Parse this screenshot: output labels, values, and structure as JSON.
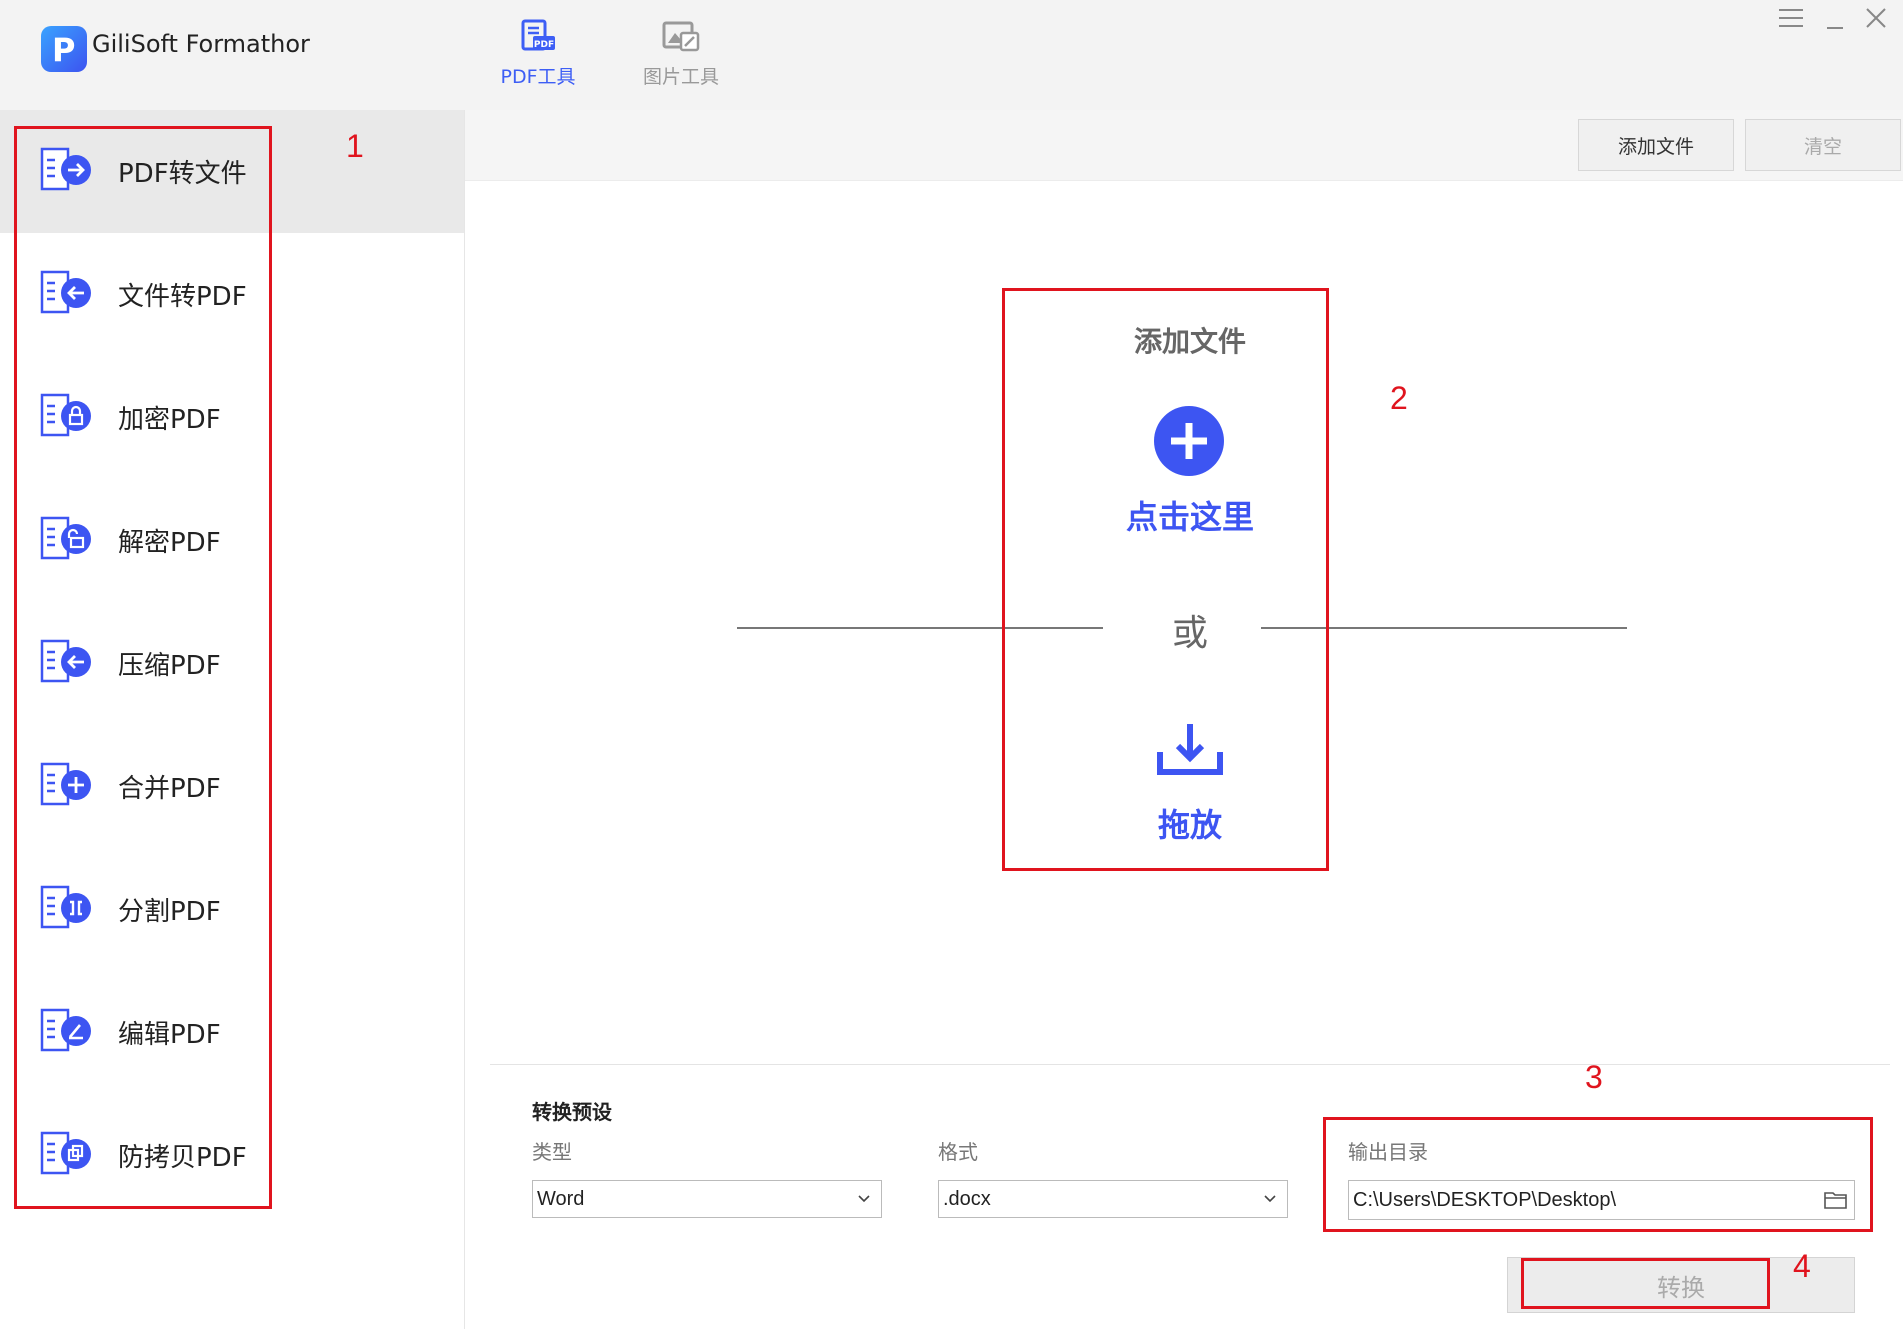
{
  "app": {
    "title": "GiliSoft Formathor",
    "logo_letter": "P"
  },
  "top_tabs": [
    {
      "label": "PDF工具",
      "icon": "pdf-tool-icon",
      "active": true
    },
    {
      "label": "图片工具",
      "icon": "image-tool-icon",
      "active": false
    }
  ],
  "sidebar": {
    "items": [
      {
        "label": "PDF转文件",
        "icon": "pdf-to-file-icon",
        "active": true
      },
      {
        "label": "文件转PDF",
        "icon": "file-to-pdf-icon"
      },
      {
        "label": "加密PDF",
        "icon": "encrypt-pdf-icon"
      },
      {
        "label": "解密PDF",
        "icon": "decrypt-pdf-icon"
      },
      {
        "label": "压缩PDF",
        "icon": "compress-pdf-icon"
      },
      {
        "label": "合并PDF",
        "icon": "merge-pdf-icon"
      },
      {
        "label": "分割PDF",
        "icon": "split-pdf-icon"
      },
      {
        "label": "编辑PDF",
        "icon": "edit-pdf-icon"
      },
      {
        "label": "防拷贝PDF",
        "icon": "copy-protect-pdf-icon"
      }
    ]
  },
  "toolbar": {
    "add_file": "添加文件",
    "clear": "清空"
  },
  "dropzone": {
    "title": "添加文件",
    "click_here": "点击这里",
    "or": "或",
    "drag": "拖放"
  },
  "settings": {
    "title": "转换预设",
    "type_label": "类型",
    "type_value": "Word",
    "format_label": "格式",
    "format_value": ".docx",
    "outdir_label": "输出目录",
    "outdir_value": "C:\\Users\\DESKTOP\\Desktop\\"
  },
  "convert_label": "转换",
  "annotations": [
    "1",
    "2",
    "3",
    "4"
  ],
  "colors": {
    "accent": "#3d55f2",
    "annotation": "#e0141e"
  }
}
